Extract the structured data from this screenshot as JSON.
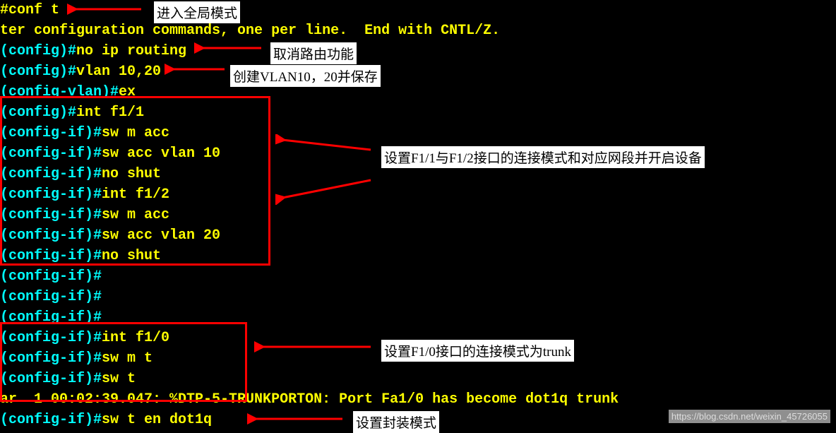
{
  "terminal": {
    "lines": [
      {
        "parts": [
          {
            "cls": "tx-yellow",
            "t": "#conf t"
          }
        ]
      },
      {
        "parts": [
          {
            "cls": "tx-yellow",
            "t": "ter configuration commands, one per line.  End with CNTL/Z."
          }
        ]
      },
      {
        "parts": [
          {
            "cls": "tx-cyan",
            "t": "(config)#"
          },
          {
            "cls": "tx-yellow",
            "t": "no ip routing"
          }
        ]
      },
      {
        "parts": [
          {
            "cls": "tx-cyan",
            "t": "(config)#"
          },
          {
            "cls": "tx-yellow",
            "t": "vlan 10,20"
          }
        ]
      },
      {
        "parts": [
          {
            "cls": "tx-cyan",
            "t": "(config-vlan)#"
          },
          {
            "cls": "tx-yellow",
            "t": "ex"
          }
        ]
      },
      {
        "parts": [
          {
            "cls": "tx-cyan",
            "t": "(config)#"
          },
          {
            "cls": "tx-yellow",
            "t": "int f1/1"
          }
        ]
      },
      {
        "parts": [
          {
            "cls": "tx-cyan",
            "t": "(config-if)#"
          },
          {
            "cls": "tx-yellow",
            "t": "sw m acc"
          }
        ]
      },
      {
        "parts": [
          {
            "cls": "tx-cyan",
            "t": "(config-if)#"
          },
          {
            "cls": "tx-yellow",
            "t": "sw acc vlan 10"
          }
        ]
      },
      {
        "parts": [
          {
            "cls": "tx-cyan",
            "t": "(config-if)#"
          },
          {
            "cls": "tx-yellow",
            "t": "no shut"
          }
        ]
      },
      {
        "parts": [
          {
            "cls": "tx-cyan",
            "t": "(config-if)#"
          },
          {
            "cls": "tx-yellow",
            "t": "int f1/2"
          }
        ]
      },
      {
        "parts": [
          {
            "cls": "tx-cyan",
            "t": "(config-if)#"
          },
          {
            "cls": "tx-yellow",
            "t": "sw m acc"
          }
        ]
      },
      {
        "parts": [
          {
            "cls": "tx-cyan",
            "t": "(config-if)#"
          },
          {
            "cls": "tx-yellow",
            "t": "sw acc vlan 20"
          }
        ]
      },
      {
        "parts": [
          {
            "cls": "tx-cyan",
            "t": "(config-if)#"
          },
          {
            "cls": "tx-yellow",
            "t": "no shut"
          }
        ]
      },
      {
        "parts": [
          {
            "cls": "tx-cyan",
            "t": "(config-if)#"
          }
        ]
      },
      {
        "parts": [
          {
            "cls": "tx-cyan",
            "t": "(config-if)#"
          }
        ]
      },
      {
        "parts": [
          {
            "cls": "tx-cyan",
            "t": "(config-if)#"
          }
        ]
      },
      {
        "parts": [
          {
            "cls": "tx-cyan",
            "t": "(config-if)#"
          },
          {
            "cls": "tx-yellow",
            "t": "int f1/0"
          }
        ]
      },
      {
        "parts": [
          {
            "cls": "tx-cyan",
            "t": "(config-if)#"
          },
          {
            "cls": "tx-yellow",
            "t": "sw m t"
          }
        ]
      },
      {
        "parts": [
          {
            "cls": "tx-cyan",
            "t": "(config-if)#"
          },
          {
            "cls": "tx-yellow",
            "t": "sw t"
          }
        ]
      },
      {
        "parts": [
          {
            "cls": "tx-yellow",
            "t": "ar  1 00:02:39.047: %DTP-5-TRUNKPORTON: Port Fa1/0 has become dot1q trunk"
          }
        ]
      },
      {
        "parts": [
          {
            "cls": "tx-cyan",
            "t": "(config-if)#"
          },
          {
            "cls": "tx-yellow",
            "t": "sw t en dot1q"
          }
        ]
      }
    ]
  },
  "annotations": {
    "a1": "进入全局模式",
    "a2": "取消路由功能",
    "a3": "创建VLAN10，20并保存",
    "a4": "设置F1/1与F1/2接口的连接模式和对应网段并开启设备",
    "a5": "设置F1/0接口的连接模式为trunk",
    "a6": "设置封装模式"
  },
  "watermark": "https://blog.csdn.net/weixin_45726055"
}
